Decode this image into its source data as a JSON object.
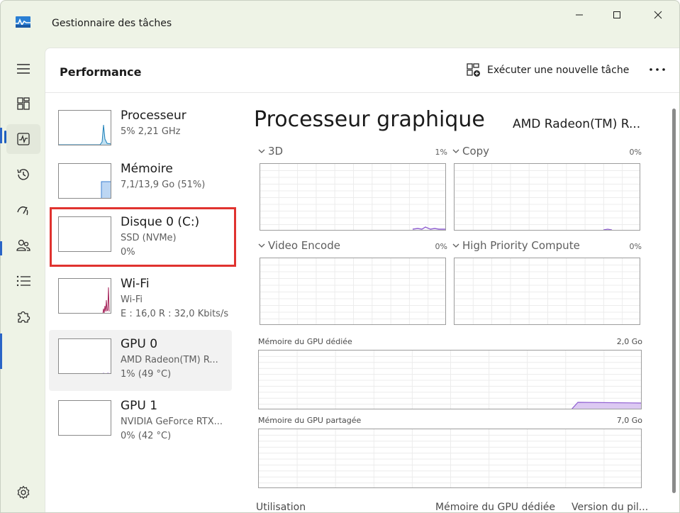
{
  "window": {
    "title": "Gestionnaire des tâches"
  },
  "header": {
    "page_title": "Performance",
    "run_task_label": "Exécuter une nouvelle tâche",
    "more_label": "•••"
  },
  "devices": [
    {
      "name": "Processeur",
      "sub1": "5% 2,21 GHz",
      "sub2": "",
      "color": "#1c7fb8",
      "usage_percent": 5
    },
    {
      "name": "Mémoire",
      "sub1": "7,1/13,9 Go (51%)",
      "sub2": "",
      "color": "#6f3ba8",
      "usage_percent": 51
    },
    {
      "name": "Disque 0 (C:)",
      "sub1": "SSD (NVMe)",
      "sub2": "0%",
      "color": "#4d8f2a",
      "usage_percent": 0
    },
    {
      "name": "Wi-Fi",
      "sub1": "Wi-Fi",
      "sub2": "E : 16,0 R : 32,0 Kbits/s",
      "color": "#a5245a"
    },
    {
      "name": "GPU 0",
      "sub1": "AMD Radeon(TM) R...",
      "sub2": "1% (49 °C)",
      "color": "#6f3ba8",
      "usage_percent": 1
    },
    {
      "name": "GPU 1",
      "sub1": "NVIDIA GeForce RTX...",
      "sub2": "0% (42 °C)",
      "color": "#6f3ba8",
      "usage_percent": 0
    }
  ],
  "gpu_detail": {
    "title": "Processeur graphique",
    "model": "AMD Radeon(TM) R...",
    "engines": [
      {
        "label": "3D",
        "percent": "1%"
      },
      {
        "label": "Copy",
        "percent": "0%"
      },
      {
        "label": "Video Encode",
        "percent": "0%"
      },
      {
        "label": "High Priority Compute",
        "percent": "0%"
      }
    ],
    "dedicated_memory": {
      "label": "Mémoire du GPU dédiée",
      "max": "2,0 Go"
    },
    "shared_memory": {
      "label": "Mémoire du GPU partagée",
      "max": "7,0 Go"
    },
    "footer": {
      "utilization": "Utilisation",
      "dedicated": "Mémoire du GPU dédiée",
      "driver": "Version du pil..."
    }
  },
  "colors": {
    "accent": "#1d5fbf",
    "selection_border": "#e0332f",
    "gpu_line": "#8f5fd1",
    "gpu_fill": "#dcc9f2"
  }
}
